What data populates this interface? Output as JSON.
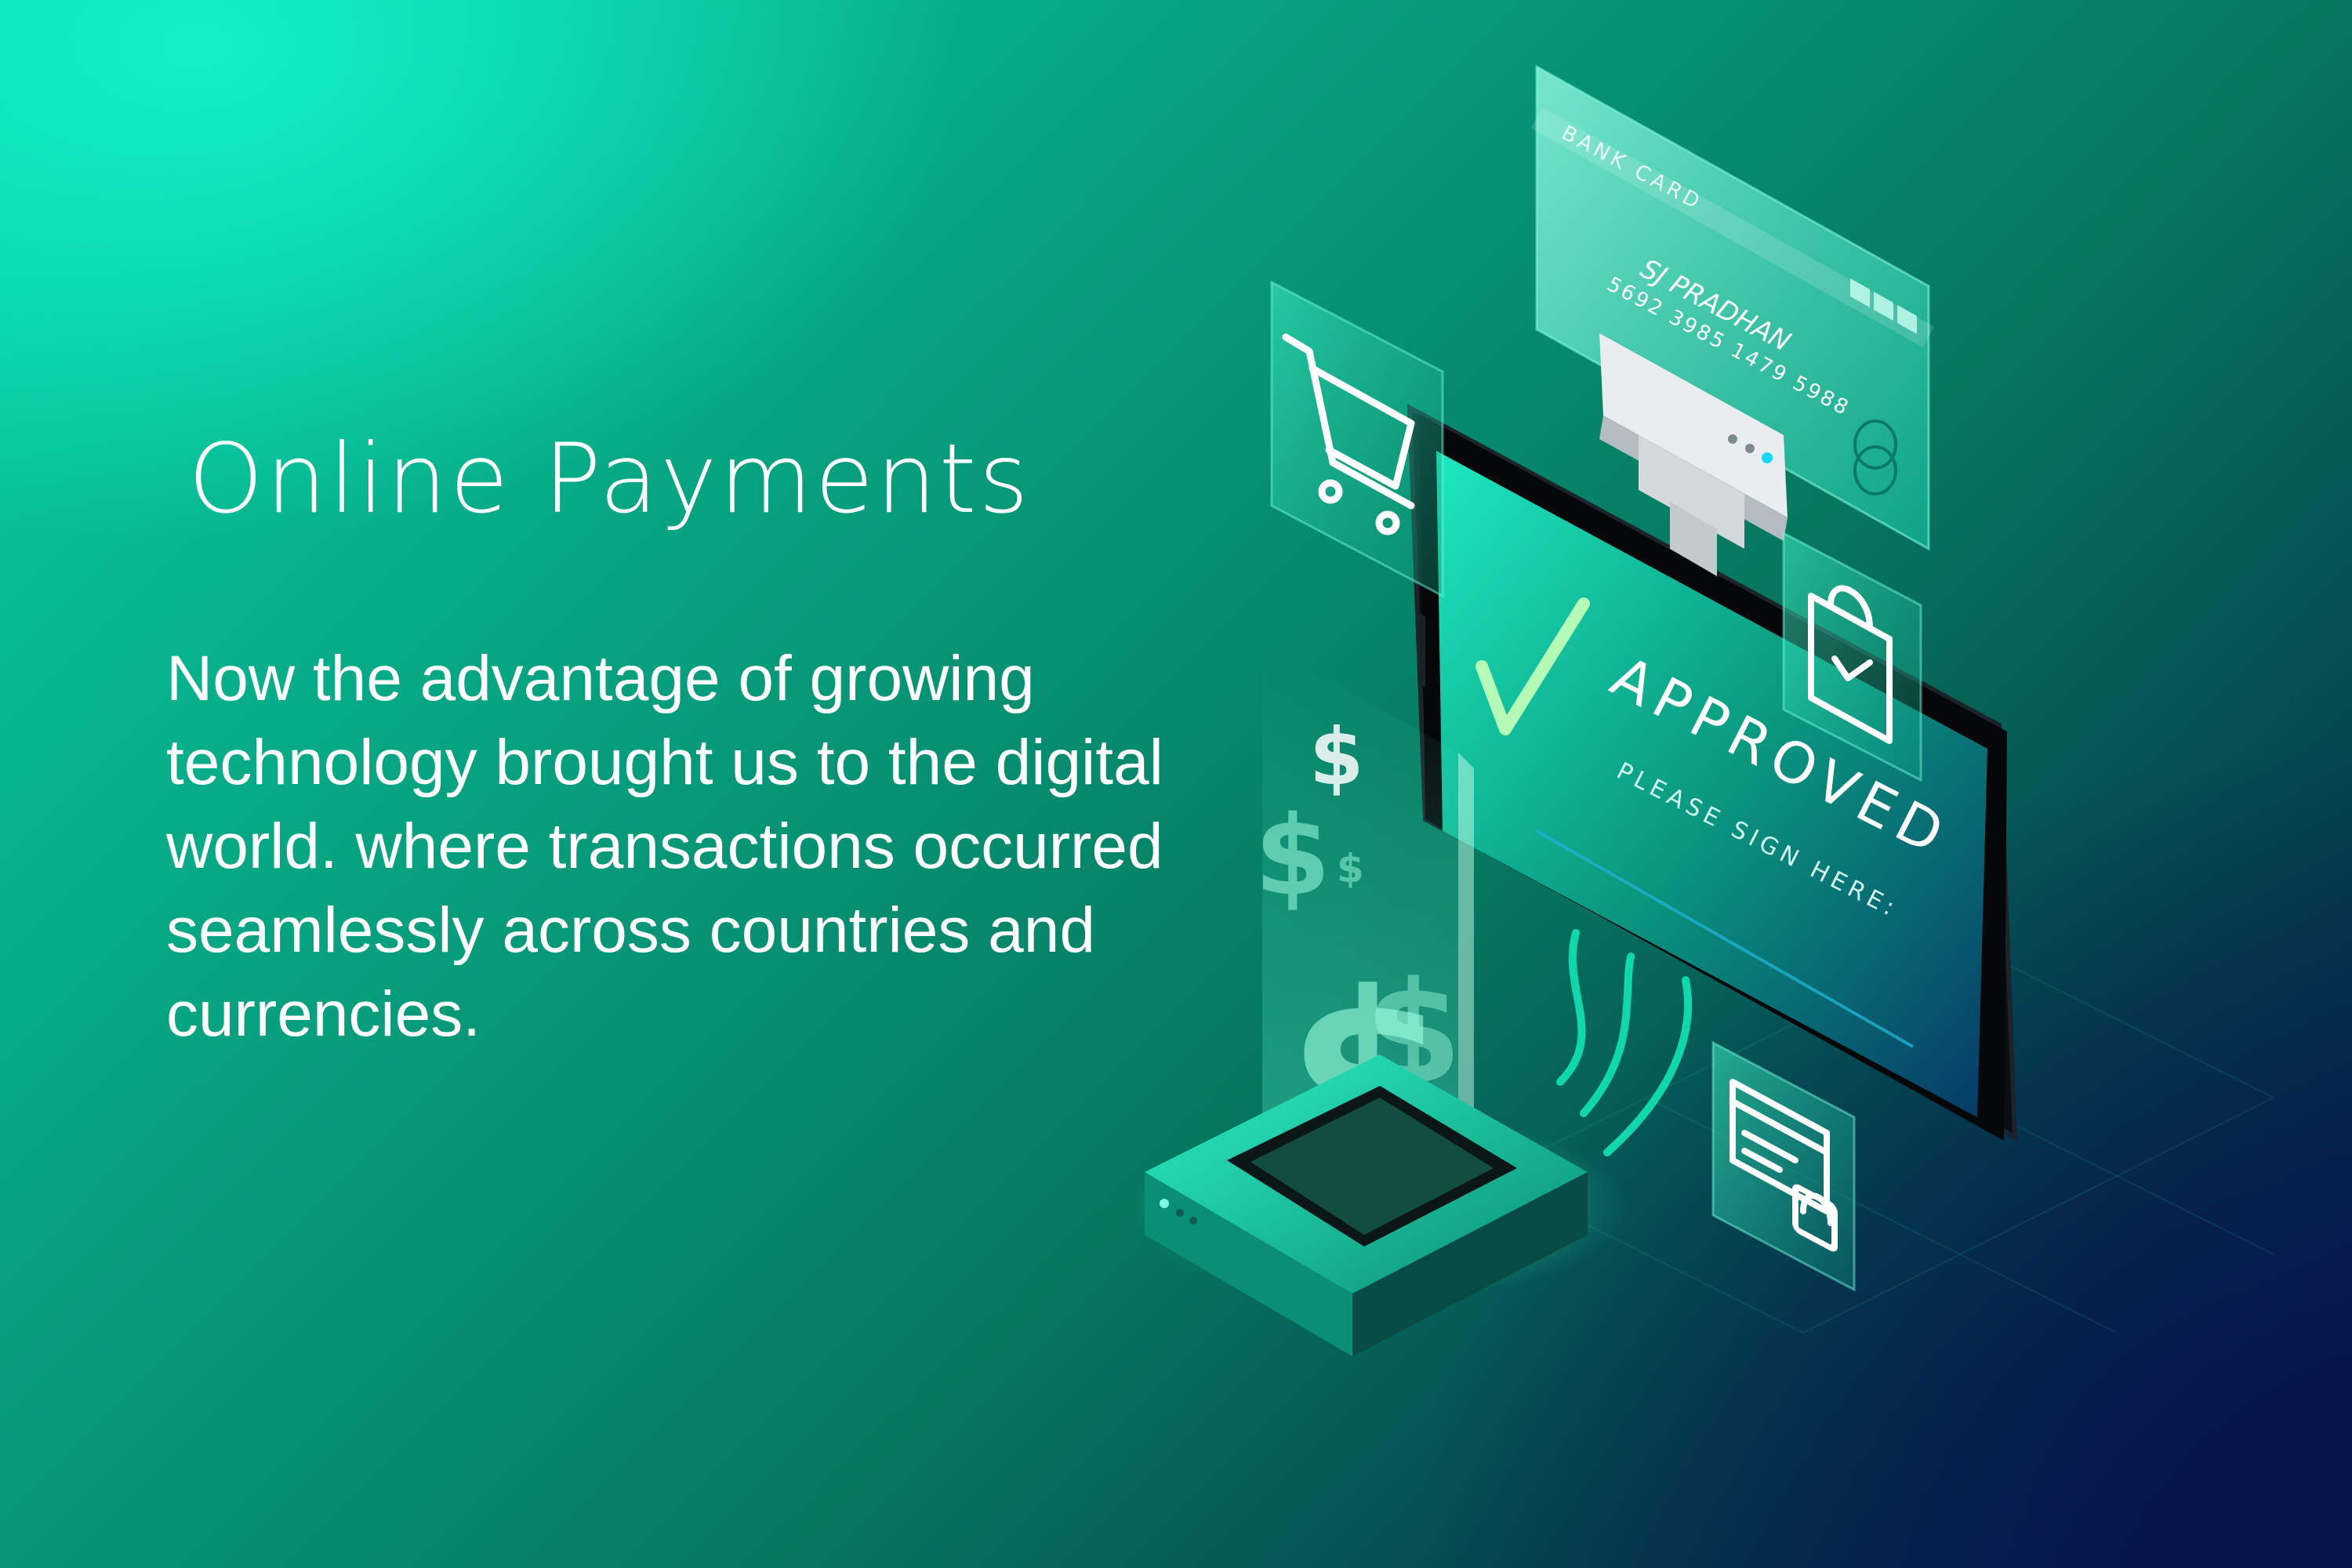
{
  "hero": {
    "title": "Online Payments",
    "description": "Now the advantage of growing technology brought us to the digital world. where transactions occurred seamlessly across countries and currencies."
  },
  "card": {
    "label": "BANK CARD",
    "holder": "SJ PRADHAN",
    "number": "5692 3985 1479 5988"
  },
  "screen": {
    "status": "APPROVED",
    "prompt": "PLEASE SIGN HERE:"
  },
  "currency_symbol": "$",
  "icons": [
    "shopping-cart-icon",
    "shopping-bag-icon",
    "secure-card-icon",
    "checkmark-icon",
    "dollar-icon"
  ],
  "colors": {
    "accent": "#0fe3b8",
    "background_top": "#06d4a6",
    "background_bottom": "#051852",
    "text": "#ffffff"
  }
}
